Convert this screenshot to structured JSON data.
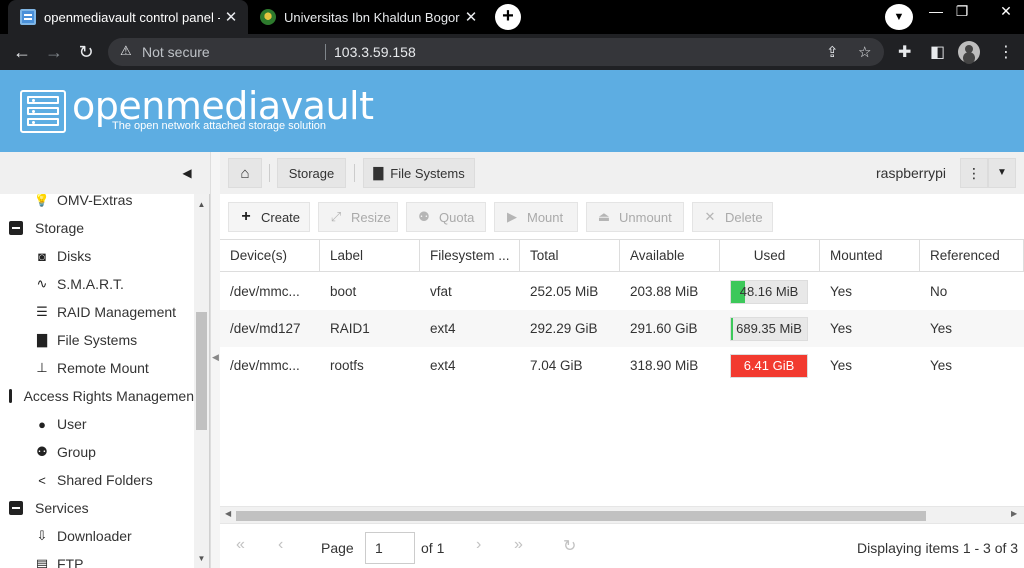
{
  "browser": {
    "tabs": [
      {
        "title": "openmediavault control panel - r",
        "active": true
      },
      {
        "title": "Universitas Ibn Khaldun Bogor",
        "active": false
      }
    ],
    "security_label": "Not secure",
    "url": "103.3.59.158"
  },
  "header": {
    "logo_text": "openmediavault",
    "tagline": "The open network attached storage solution"
  },
  "sidebar": {
    "items": [
      {
        "label": "OMV-Extras",
        "icon": "lightbulb-icon",
        "type": "child"
      },
      {
        "label": "Storage",
        "icon": "collapse-icon",
        "type": "group"
      },
      {
        "label": "Disks",
        "icon": "disk-icon",
        "type": "child"
      },
      {
        "label": "S.M.A.R.T.",
        "icon": "pulse-icon",
        "type": "child"
      },
      {
        "label": "RAID Management",
        "icon": "database-icon",
        "type": "child"
      },
      {
        "label": "File Systems",
        "icon": "folders-icon",
        "type": "child"
      },
      {
        "label": "Remote Mount",
        "icon": "network-icon",
        "type": "child"
      },
      {
        "label": "Access Rights Managemen",
        "icon": "collapse-icon",
        "type": "group"
      },
      {
        "label": "User",
        "icon": "user-icon",
        "type": "child"
      },
      {
        "label": "Group",
        "icon": "group-icon",
        "type": "child"
      },
      {
        "label": "Shared Folders",
        "icon": "share-icon",
        "type": "child"
      },
      {
        "label": "Services",
        "icon": "collapse-icon",
        "type": "group"
      },
      {
        "label": "Downloader",
        "icon": "download-icon",
        "type": "child"
      },
      {
        "label": "FTP",
        "icon": "server-icon",
        "type": "child"
      }
    ]
  },
  "breadcrumb": {
    "items": [
      "Storage",
      "File Systems"
    ],
    "hostname": "raspberrypi"
  },
  "actions": {
    "create": "Create",
    "resize": "Resize",
    "quota": "Quota",
    "mount": "Mount",
    "unmount": "Unmount",
    "delete": "Delete"
  },
  "grid": {
    "columns": [
      "Device(s)",
      "Label",
      "Filesystem ...",
      "Total",
      "Available",
      "Used",
      "Mounted",
      "Referenced"
    ],
    "rows": [
      {
        "device": "/dev/mmc...",
        "label": "boot",
        "fs": "vfat",
        "total": "252.05 MiB",
        "available": "203.88 MiB",
        "used": "48.16 MiB",
        "used_fraction": 0.19,
        "used_color": "#3cc85a",
        "mounted": "Yes",
        "referenced": "No"
      },
      {
        "device": "/dev/md127",
        "label": "RAID1",
        "fs": "ext4",
        "total": "292.29 GiB",
        "available": "291.60 GiB",
        "used": "689.35 MiB",
        "used_fraction": 0.01,
        "used_color": "#3cc85a",
        "mounted": "Yes",
        "referenced": "Yes"
      },
      {
        "device": "/dev/mmc...",
        "label": "rootfs",
        "fs": "ext4",
        "total": "7.04 GiB",
        "available": "318.90 MiB",
        "used": "6.41 GiB",
        "used_fraction": 1.0,
        "used_color": "#f23a2f",
        "mounted": "Yes",
        "referenced": "Yes"
      }
    ]
  },
  "pager": {
    "page_label": "Page",
    "page_value": "1",
    "of_label": "of 1",
    "display_text": "Displaying items 1 - 3 of 3"
  }
}
